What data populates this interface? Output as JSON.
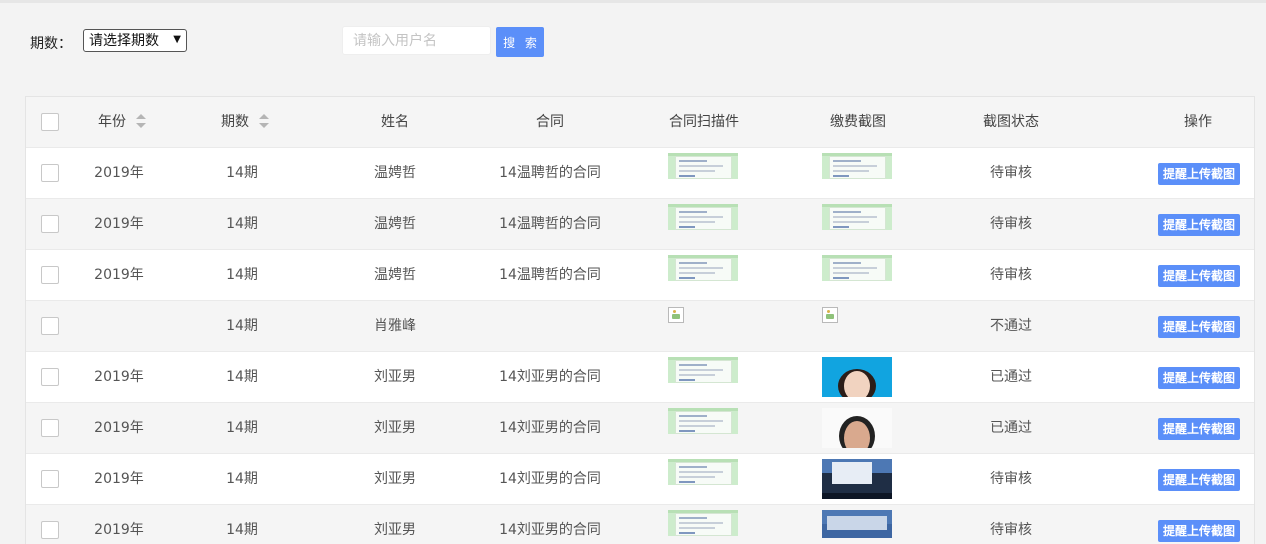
{
  "filter": {
    "period_label": "期数：",
    "period_select_value": "请选择期数",
    "search_placeholder": "请输入用户名",
    "search_value": "",
    "search_button": "搜 索"
  },
  "table": {
    "headers": {
      "year": "年份",
      "period": "期数",
      "name": "姓名",
      "contract": "合同",
      "contract_scan": "合同扫描件",
      "payment_screenshot": "缴费截图",
      "status": "截图状态",
      "action": "操作"
    },
    "action_label": "提醒上传截图",
    "rows": [
      {
        "year": "2019年",
        "period": "14期",
        "name": "温娉哲",
        "contract": "14温聘哲的合同",
        "scan": "document-thumbnail",
        "payment": "document-thumbnail",
        "status": "待审核"
      },
      {
        "year": "2019年",
        "period": "14期",
        "name": "温娉哲",
        "contract": "14温聘哲的合同",
        "scan": "document-thumbnail",
        "payment": "document-thumbnail",
        "status": "待审核"
      },
      {
        "year": "2019年",
        "period": "14期",
        "name": "温娉哲",
        "contract": "14温聘哲的合同",
        "scan": "document-thumbnail",
        "payment": "document-thumbnail",
        "status": "待审核"
      },
      {
        "year": "",
        "period": "14期",
        "name": "肖雅峰",
        "contract": "",
        "scan": "broken-image-icon",
        "payment": "broken-image-icon",
        "status": "不通过"
      },
      {
        "year": "2019年",
        "period": "14期",
        "name": "刘亚男",
        "contract": "14刘亚男的合同",
        "scan": "document-thumbnail",
        "payment": "id-photo-blue-thumbnail",
        "status": "已通过"
      },
      {
        "year": "2019年",
        "period": "14期",
        "name": "刘亚男",
        "contract": "14刘亚男的合同",
        "scan": "document-thumbnail",
        "payment": "id-photo-white-thumbnail",
        "status": "已通过"
      },
      {
        "year": "2019年",
        "period": "14期",
        "name": "刘亚男",
        "contract": "14刘亚男的合同",
        "scan": "document-thumbnail",
        "payment": "desktop-screenshot-thumbnail",
        "status": "待审核"
      },
      {
        "year": "2019年",
        "period": "14期",
        "name": "刘亚男",
        "contract": "14刘亚男的合同",
        "scan": "document-thumbnail",
        "payment": "desktop-screenshot-thumbnail",
        "status": "待审核"
      }
    ]
  },
  "colors": {
    "primary": "#5b8ff9",
    "page_background": "#f3f3f3",
    "row_stripe": "#f5f5f5"
  }
}
